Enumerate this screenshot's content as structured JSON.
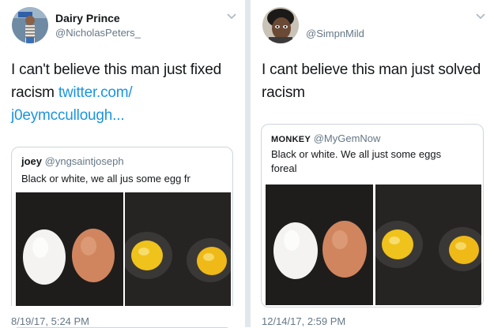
{
  "left_tweet": {
    "display_name": "Dairy Prince",
    "handle": "@NicholasPeters_",
    "text_line1": "I can't believe this man just fixed",
    "text_line2_plain": "racism ",
    "text_line2_link": "twitter.com/",
    "text_line3_link": "j0eymccullough...",
    "quote": {
      "name": "joey",
      "handle": "@yngsaintjoseph",
      "text": "Black or white, we all jus some egg fr"
    },
    "timestamp": "8/19/17, 5:24 PM"
  },
  "right_tweet": {
    "display_name": "",
    "handle": "@SimpnMild",
    "text_line1": "I cant believe this man just solved",
    "text_line2": "racism",
    "quote": {
      "name": "MONKEY",
      "handle": "@MyGemNow",
      "text_line1": "Black or white. We all just some eggs",
      "text_line2": "foreal"
    },
    "timestamp": "12/14/17, 2:59 PM"
  },
  "icons": {
    "caret": "chevron-down-icon"
  },
  "colors": {
    "link": "#1b95e0",
    "secondary_text": "#657786",
    "border": "#ccd6dd"
  }
}
